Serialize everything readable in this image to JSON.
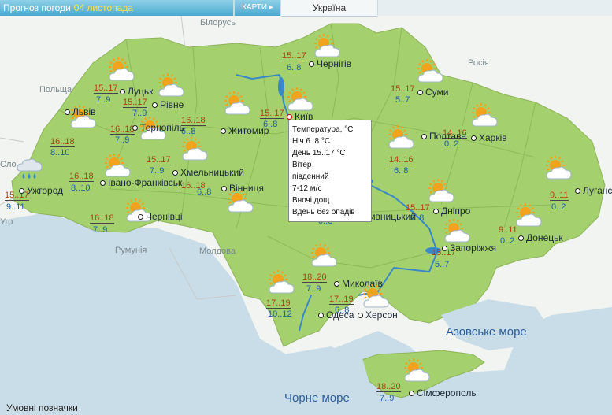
{
  "header": {
    "title": "Прогноз погоди",
    "date": "04 листопада",
    "maps_tab": "КАРТИ",
    "maps_arrow": "▸",
    "country": "Україна"
  },
  "neighbors": {
    "belarus": "Білорусь",
    "russia": "Росія",
    "poland": "Польща",
    "romania": "Румунія",
    "moldova": "Молдова",
    "slovakia_partial": "Сло",
    "hungary_partial": "Уго"
  },
  "seas": {
    "azov": "Азовське море",
    "black": "Чорне море"
  },
  "cities": [
    {
      "name": "Чернігів",
      "day": "15..17",
      "night": "6..8",
      "icon": "sun-cloud-icon"
    },
    {
      "name": "Луцьк",
      "day": "15..17",
      "night": "7..9",
      "icon": "sun-cloud-icon"
    },
    {
      "name": "Рівне",
      "day": "15..17",
      "night": "7..9",
      "icon": "sun-cloud-icon"
    },
    {
      "name": "Київ",
      "day": "15..17",
      "night": "6..8",
      "icon": "sun-cloud-icon"
    },
    {
      "name": "Суми",
      "day": "15..17",
      "night": "5..7",
      "icon": "sun-cloud-icon"
    },
    {
      "name": "Житомир",
      "day": "16..18",
      "night": "6..8",
      "icon": "sun-cloud-icon"
    },
    {
      "name": "Львів",
      "day": "16..18",
      "night": "8..10",
      "icon": "sun-cloud-icon"
    },
    {
      "name": "Тернопіль",
      "day": "16..18",
      "night": "7..9",
      "icon": "sun-cloud-icon"
    },
    {
      "name": "Хмельницький",
      "day": "15..17",
      "night": "7..9",
      "icon": "sun-cloud-icon"
    },
    {
      "name": "Харків",
      "day": "14..16",
      "night": "0..2",
      "icon": "sun-cloud-icon"
    },
    {
      "name": "Полтава",
      "day": "14..16",
      "night": "6..8",
      "icon": "sun-cloud-icon"
    },
    {
      "name": "Ужгород",
      "day": "15..17",
      "night": "9..11",
      "icon": "cloud-rain-icon"
    },
    {
      "name": "Івано-Франківськ",
      "day": "16..18",
      "night": "8..10",
      "icon": "sun-cloud-icon"
    },
    {
      "name": "Вінниця",
      "day": "16..18",
      "night": "6..8",
      "icon": "sun-cloud-icon"
    },
    {
      "name": "Луганськ",
      "day": "9..11",
      "night": "0..2",
      "icon": "sun-cloud-icon"
    },
    {
      "name": "Дніпро",
      "day": "15..17",
      "night": "6..8",
      "icon": "sun-cloud-icon"
    },
    {
      "name": "Чернівці",
      "day": "16..18",
      "night": "7..9",
      "icon": "sun-cloud-icon"
    },
    {
      "name": "Кропивницький",
      "day": "",
      "night": "6..8",
      "icon": "sun-cloud-icon"
    },
    {
      "name": "Донецьк",
      "day": "9..11",
      "night": "0..2",
      "icon": "sun-cloud-icon"
    },
    {
      "name": "Запоріжжя",
      "day": "15..17",
      "night": "5..7",
      "icon": "sun-cloud-icon"
    },
    {
      "name": "Миколаїв",
      "day": "18..20",
      "night": "7..9",
      "icon": "sun-cloud-icon"
    },
    {
      "name": "Одеса",
      "day": "17..19",
      "night": "10..12",
      "icon": "sun-cloud-icon"
    },
    {
      "name": "Херсон",
      "day": "17..19",
      "night": "6..8",
      "icon": "sun-cloud-icon"
    },
    {
      "name": "Сімферополь",
      "day": "18..20",
      "night": "7..9",
      "icon": "sun-cloud-icon"
    }
  ],
  "tooltip": {
    "line1": "Температура, °С",
    "line2": "Ніч 6..8 °С",
    "line3": "День 15..17 °С",
    "line4": "Вітер",
    "line5": "південний",
    "line6": "7-12 м/с",
    "line7": "Вночі дощ",
    "line8": "Вдень без опадів"
  },
  "legend": "Умовні позначки",
  "colors": {
    "land": "#a4d06e",
    "neighbor_land": "#f1f4f1",
    "sea": "#c9dde8",
    "day_temp": "#b04010",
    "night_temp": "#1e5fa8",
    "sun": "#f2a21c",
    "river": "#3b88c8"
  }
}
